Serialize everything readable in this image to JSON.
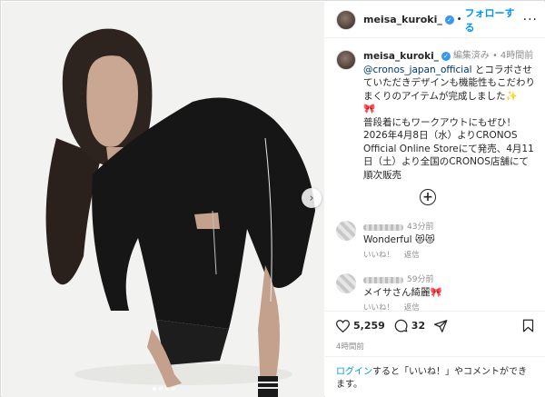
{
  "post": {
    "username": "meisa_kuroki_",
    "verified_glyph": "✓",
    "separator": "•",
    "follow_label": "フォローする",
    "more_glyph": "···"
  },
  "media": {
    "next_glyph": "›",
    "carousel_dots": 4,
    "active_dot": 0
  },
  "caption": {
    "username": "meisa_kuroki_",
    "edited_label": "編集済み",
    "separator": "•",
    "time": "4時間前",
    "mention": "@cronos_japan_official",
    "line1": " とコラボさせていただきデザインも機能性もこだわりまくりのアイテムが完成しました",
    "sparkle": "✨",
    "ribbon": "🎀",
    "line2": "普段着にもワークアウトにもぜひ！",
    "line3": "2026年4月8日（水）よりCRONOS Official Online Storeにて発売、4月11日（土）より全国のCRONOS店舗にて順次販売",
    "load_more_glyph": "+"
  },
  "comments": [
    {
      "time": "43分前",
      "text": "Wonderful 😻😻",
      "like_label": "いいね！",
      "reply_label": "返信"
    },
    {
      "time": "59分前",
      "text": "メイサさん綺麗🎀",
      "like_label": "いいね！",
      "reply_label": "返信"
    }
  ],
  "actions": {
    "likes": "5,259",
    "comments": "32",
    "post_time": "4時間前"
  },
  "login": {
    "link": "ログイン",
    "text": "すると「いいね！」やコメントができます。"
  },
  "colors": {
    "link_blue": "#0095f6",
    "mention_blue": "#00376b",
    "muted": "#8e8e8e"
  }
}
